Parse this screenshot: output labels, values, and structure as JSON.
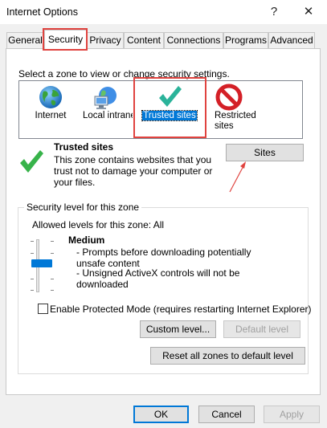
{
  "window": {
    "title": "Internet Options",
    "help_label": "?",
    "close_label": "✕"
  },
  "tabs": [
    {
      "label": "General"
    },
    {
      "label": "Security"
    },
    {
      "label": "Privacy"
    },
    {
      "label": "Content"
    },
    {
      "label": "Connections"
    },
    {
      "label": "Programs"
    },
    {
      "label": "Advanced"
    }
  ],
  "active_tab": "Security",
  "security": {
    "zone_prompt": "Select a zone to view or change security settings.",
    "zones": [
      {
        "label": "Internet",
        "icon": "globe-icon"
      },
      {
        "label": "Local intranet",
        "icon": "network-icon"
      },
      {
        "label": "Trusted sites",
        "icon": "checkmark-icon",
        "selected": true
      },
      {
        "label": "Restricted sites",
        "icon": "no-entry-icon"
      }
    ],
    "zone_detail": {
      "title": "Trusted sites",
      "description": "This zone contains websites that you trust not to damage your computer or your files.",
      "sites_button": "Sites"
    },
    "level_group": {
      "label": "Security level for this zone",
      "allowed": "Allowed levels for this zone: All",
      "level_name": "Medium",
      "bullets": [
        "- Prompts before downloading potentially unsafe content",
        "- Unsigned ActiveX controls will not be downloaded"
      ],
      "protected_mode_label": "Enable Protected Mode (requires restarting Internet Explorer)",
      "protected_mode_checked": false,
      "custom_level_button": "Custom level...",
      "default_level_button": "Default level"
    },
    "reset_all_button": "Reset all zones to default level"
  },
  "footer": {
    "ok": "OK",
    "cancel": "Cancel",
    "apply": "Apply"
  },
  "colors": {
    "accent": "#0078d7",
    "highlight_box": "#e0433f"
  }
}
